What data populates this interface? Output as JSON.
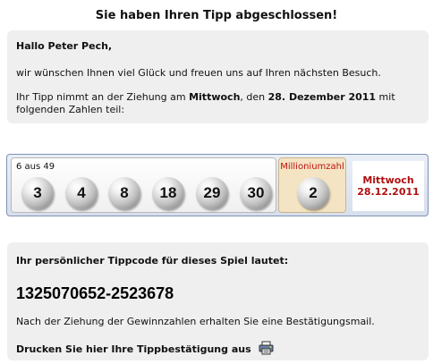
{
  "page": {
    "title": "Sie haben Ihren Tipp abgeschlossen!"
  },
  "greeting_panel": {
    "greeting": "Hallo Peter Pech,",
    "wish": "wir wünschen Ihnen viel Glück und freuen uns auf Ihren nächsten Besuch.",
    "tipp_prefix": "Ihr Tipp nimmt an der Ziehung am ",
    "draw_day": "Mittwoch",
    "tipp_middle": ", den ",
    "draw_date_long": "28. Dezember 2011",
    "tipp_suffix": " mit folgenden Zahlen teil:"
  },
  "lotto": {
    "numbers_label": "6 aus 49",
    "numbers": [
      "3",
      "4",
      "8",
      "18",
      "29",
      "30"
    ],
    "million_label": "Millioniumzahl",
    "million_number": "2",
    "draw_day": "Mittwoch",
    "draw_date": "28.12.2011",
    "accent_color": "#b01010",
    "strip_border_color": "#7f93b5",
    "million_box_color": "#f4e4c3"
  },
  "code_panel": {
    "heading": "Ihr persönlicher Tippcode für dieses Spiel lautet:",
    "tippcode": "1325070652-2523678",
    "confirmation": "Nach der Ziehung der Gewinnzahlen erhalten Sie eine Bestätigungsmail.",
    "print_label": "Drucken Sie hier Ihre Tippbestätigung aus",
    "print_icon": "printer-icon"
  }
}
